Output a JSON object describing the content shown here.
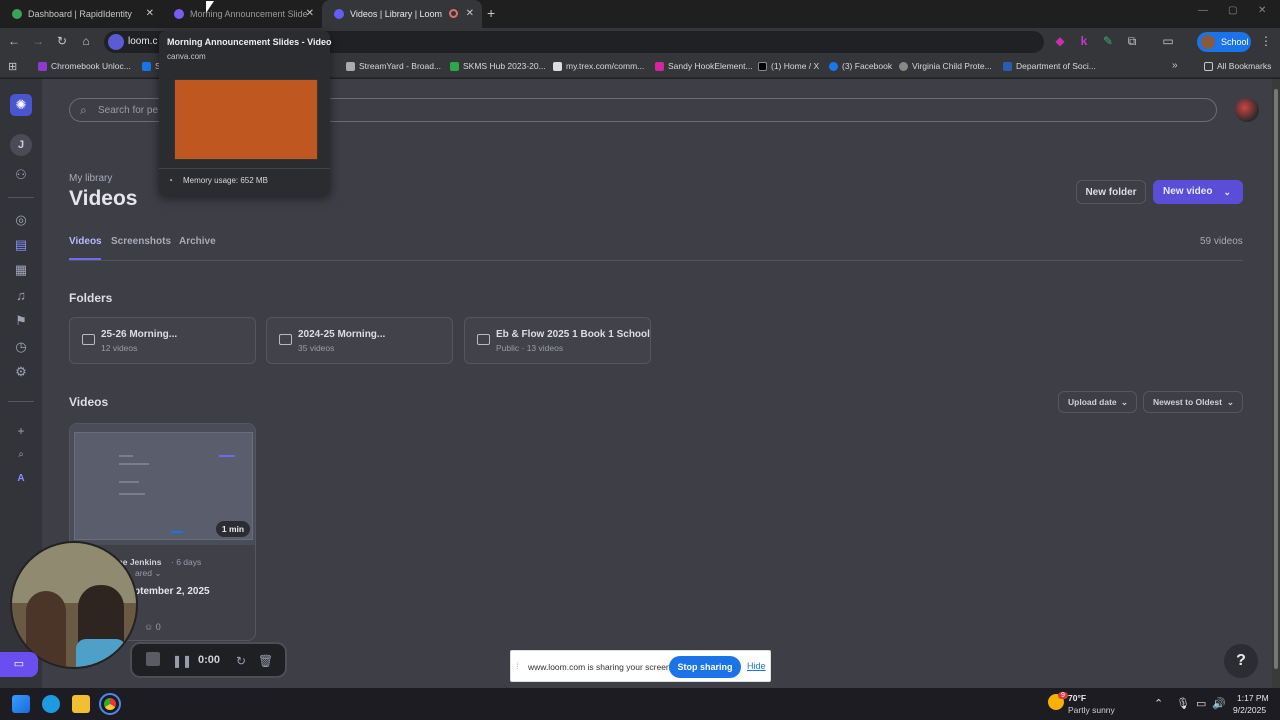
{
  "browser": {
    "tabs": [
      {
        "label": "Dashboard | RapidIdentity",
        "active": false
      },
      {
        "label": "Morning Announcement Slide",
        "active": false
      },
      {
        "label": "Videos | Library | Loom",
        "active": true
      }
    ],
    "omnibox": {
      "url": "loom.c"
    },
    "profile_label": "School",
    "bookmarks": [
      "Chromebook Unloc...",
      "S",
      "StreamYard - Broad...",
      "SKMS Hub 2023-20...",
      "my.trex.com/comm...",
      "Sandy HookElement...",
      "(1) Home / X",
      "(3) Facebook",
      "Virginia Child Prote...",
      "Department of Soci..."
    ],
    "all_bookmarks_label": "All Bookmarks"
  },
  "tooltip": {
    "title": "Morning Announcement Slides - Video",
    "domain": "canva.com",
    "memory": "Memory usage: 652 MB"
  },
  "sidebar": {
    "workspace_initial": "J",
    "bottom_initial": "A"
  },
  "search": {
    "placeholder": "Search for pe"
  },
  "header": {
    "breadcrumb": "My library",
    "title": "Videos",
    "new_folder_label": "New folder",
    "new_video_label": "New video"
  },
  "tabs": [
    {
      "label": "Videos",
      "active": true
    },
    {
      "label": "Screenshots",
      "active": false
    },
    {
      "label": "Archive",
      "active": false
    }
  ],
  "video_count": "59 videos",
  "folders_heading": "Folders",
  "folders": [
    {
      "name": "25-26 Morning...",
      "meta": "12 videos"
    },
    {
      "name": "2024-25 Morning...",
      "meta": "35 videos"
    },
    {
      "name": "Eb & Flow 2025 1 Book 1 School",
      "meta": "Public · 13 videos"
    }
  ],
  "videos_heading": "Videos",
  "sort": {
    "field": "Upload date",
    "order": "Newest to Oldest"
  },
  "video": {
    "duration": "1 min",
    "author": "ae Jenkins",
    "age": "· 6 days",
    "shared": "ared",
    "title": "ptember 2, 2025",
    "comments": "0"
  },
  "recorder": {
    "timer": "0:00"
  },
  "share_banner": {
    "message": "www.loom.com is sharing your screen.",
    "stop_label": "Stop sharing",
    "hide_label": "Hide"
  },
  "help_label": "?",
  "taskbar": {
    "weather_temp": "70°F",
    "weather_desc": "Partly sunny",
    "weather_badge": "9",
    "time": "1:17 PM",
    "date": "9/2/2025"
  },
  "colors": {
    "accent": "#6b6bf0",
    "stop_button": "#1a73e8",
    "preview": "#bf5720"
  }
}
